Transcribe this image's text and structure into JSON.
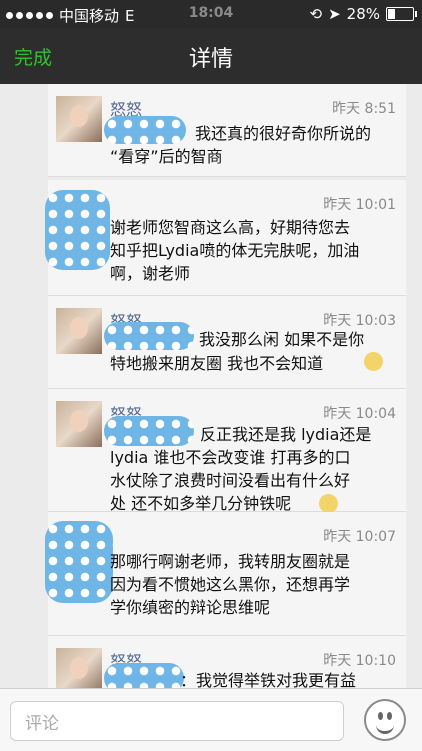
{
  "status": {
    "carrier": "中国移动",
    "network": "E",
    "time": "18:04",
    "battery": "28%"
  },
  "nav": {
    "back": "完成",
    "title": "详情"
  },
  "comments": [
    {
      "name": "怒怒",
      "time": "昨天 8:51",
      "lines": [
        "我还真的很好奇你所说的",
        "“看穿”后的智商"
      ]
    },
    {
      "name": "",
      "time": "昨天 10:01",
      "lines": [
        "谢老师您智商这么高，好期待您去",
        "知乎把Lydia喷的体无完肤呢，加油",
        "啊，谢老师"
      ]
    },
    {
      "name": "怒怒",
      "time": "昨天 10:03",
      "lines": [
        "我没那么闲 如果不是你",
        "特地搬来朋友圈 我也不会知道"
      ]
    },
    {
      "name": "怒怒",
      "time": "昨天 10:04",
      "lines": [
        "反正我还是我 lydia还是",
        "lydia 谁也不会改变谁 打再多的口",
        "水仗除了浪费时间没看出有什么好",
        "处 还不如多举几分钟铁呢"
      ]
    },
    {
      "name": "",
      "time": "昨天 10:07",
      "lines": [
        "那哪行啊谢老师，我转朋友圈就是",
        "因为看不惯她这么黑你，还想再学",
        "学你缜密的辩论思维呢"
      ]
    },
    {
      "name": "怒怒",
      "time": "昨天 10:10",
      "lines": [
        "：我觉得举铁对我更有益"
      ]
    }
  ],
  "footer": {
    "placeholder": "评论"
  },
  "colors": {
    "accent": "#2fc230",
    "name": "#566a94",
    "pattern": "#6fb6e6"
  }
}
